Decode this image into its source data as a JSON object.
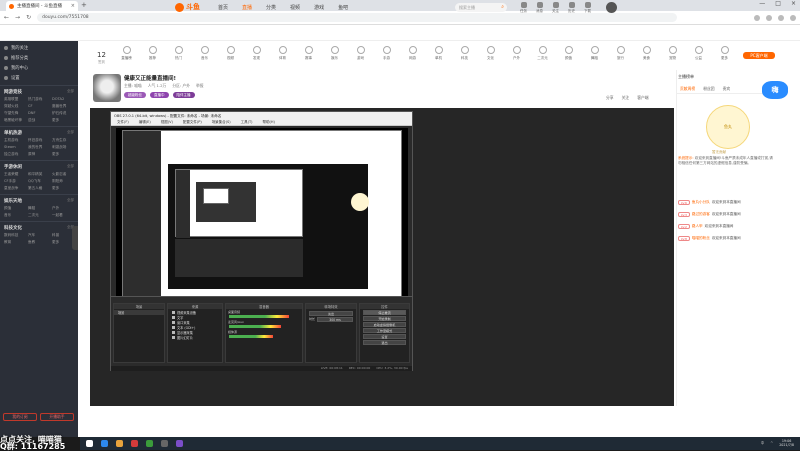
{
  "browser": {
    "tab_title": "主播直播间 - 斗鱼直播",
    "tab_close": "×",
    "new_tab": "+",
    "url": "douyu.com/7551708",
    "window_controls": [
      "—",
      "□",
      "×"
    ]
  },
  "site": {
    "logo_text": "斗鱼",
    "nav": [
      "首页",
      "直播",
      "分类",
      "视频",
      "游戏",
      "鱼吧"
    ],
    "nav_active_index": 1,
    "search_placeholder": "搜索主播",
    "header_icons": [
      "任务",
      "消息",
      "关注",
      "历史",
      "下载"
    ]
  },
  "sidebar": {
    "top_items": [
      "我的关注",
      "推荐分类",
      "我的中心",
      "设置"
    ],
    "sections": [
      {
        "title": "网游竞技",
        "more": "全部",
        "items": [
          "英雄联盟",
          "热门游戏",
          "DOTA2",
          "穿越火线",
          "CF",
          "魔兽世界",
          "守望先锋",
          "DNF",
          "炉石传说",
          "暗黑破坏神",
          "逆战",
          "更多"
        ]
      },
      {
        "title": "单机热游",
        "more": "全部",
        "items": [
          "主机游戏",
          "怀旧游戏",
          "方舟生存",
          "Steam",
          "我的世界",
          "刺激战场",
          "独立游戏",
          "原神",
          "更多"
        ]
      },
      {
        "title": "手游休闲",
        "more": "全部",
        "items": [
          "王者荣耀",
          "和平精英",
          "火影忍者",
          "CF手游",
          "QQ飞车",
          "阴阳师",
          "皇室战争",
          "第五人格",
          "更多"
        ]
      },
      {
        "title": "娱乐天地",
        "more": "全部",
        "items": [
          "颜值",
          "舞蹈",
          "户外",
          "音乐",
          "二次元",
          "一起看"
        ]
      },
      {
        "title": "科技文化",
        "more": "全部",
        "items": [
          "数码科技",
          "汽车",
          "科普",
          "教育",
          "鱼教",
          "更多"
        ]
      }
    ],
    "bottom_buttons": [
      "我的订阅",
      "开播助手"
    ]
  },
  "categories": {
    "date_num": "12",
    "date_label": "签到",
    "items": [
      "直播榜",
      "推荐",
      "热门",
      "音乐",
      "视频",
      "发现",
      "体育",
      "赛事",
      "娱乐",
      "游戏",
      "手游",
      "网游",
      "单机",
      "科技",
      "文化",
      "户外",
      "二次元",
      "颜值",
      "舞蹈",
      "旅行",
      "美食",
      "宠物",
      "公益",
      "更多"
    ],
    "pc_button": "PC客户端"
  },
  "streamer": {
    "title": "健康又正能量直播间!",
    "meta": [
      "主播: 喵喵",
      "人气 1.2万",
      "分区: 户外",
      "举报"
    ],
    "tags": [
      "超级粉丝",
      "直播中",
      "陪伴主播"
    ],
    "tag_colors": [
      "#9b59b6",
      "#8e44ad",
      "#7d3c98"
    ],
    "actions": [
      "分享",
      "关注",
      "客户端"
    ]
  },
  "obs": {
    "window_title": "OBS 27.0.1 (64-bit, windows) - 配置文件: 未命名 - 场景: 未命名",
    "menu": [
      "文件(F)",
      "编辑(E)",
      "视图(V)",
      "配置文件(P)",
      "场景集合(S)",
      "工具(T)",
      "帮助(H)"
    ],
    "panels": [
      "场景",
      "来源",
      "混音器",
      "转场特效",
      "控件"
    ],
    "sources": [
      "视频采集设备",
      "文字",
      "窗口采集",
      "文本 (GDI+)",
      "显示器采集",
      "图片幻灯片"
    ],
    "mixers": [
      "桌面音频",
      "麦克风/Aux",
      "媒体源"
    ],
    "controls": [
      "停止推流",
      "开始录制",
      "启动虚拟摄像机",
      "工作室模式",
      "设置",
      "退出"
    ],
    "transition_label": "淡出",
    "duration_label": "时长",
    "duration_value": "300 ms",
    "scene_item": "场景",
    "status": [
      "LIVE: 00:08:11",
      "REC: 00:00:00",
      "CPU: 3.2%, 30.00 fps"
    ]
  },
  "chat": {
    "rank_title": "主播榜单",
    "tabs": [
      "贡献周榜",
      "粉丝团",
      "贵宾"
    ],
    "active_tab": 0,
    "mascot_text": "鱼丸",
    "mascot_caption": "暂无贡献",
    "bubble_text": "嗨",
    "welcome_user": "系统提示:",
    "welcome_text": "欢迎来到直播间!斗鱼严禁未成年人直播或打赏,请勿相信任何第三方网站的虚假信息,谨防受骗。",
    "lines": [
      {
        "badge": "LV.6",
        "user": "鱼丸小分队",
        "text": "欢迎来到本直播间"
      },
      {
        "badge": "LV.3",
        "user": "路过的游客",
        "text": "欢迎来到本直播间"
      },
      {
        "badge": "LV.2",
        "user": "路人甲",
        "text": "欢迎来到本直播间"
      },
      {
        "badge": "LV.8",
        "user": "喵喵的粉丝",
        "text": "欢迎来到本直播间"
      }
    ]
  },
  "overlay": {
    "line1": "点点关注, 喵喵猫",
    "line2": "Q群: 11167285"
  },
  "taskbar": {
    "app_colors": [
      "#2d89ef",
      "#e8a33d",
      "#d43b3b",
      "#3b9c3b",
      "#666",
      "#7b4ec9"
    ],
    "tray": [
      "中",
      "^"
    ],
    "time": "19:06",
    "date": "2021/7/8"
  }
}
